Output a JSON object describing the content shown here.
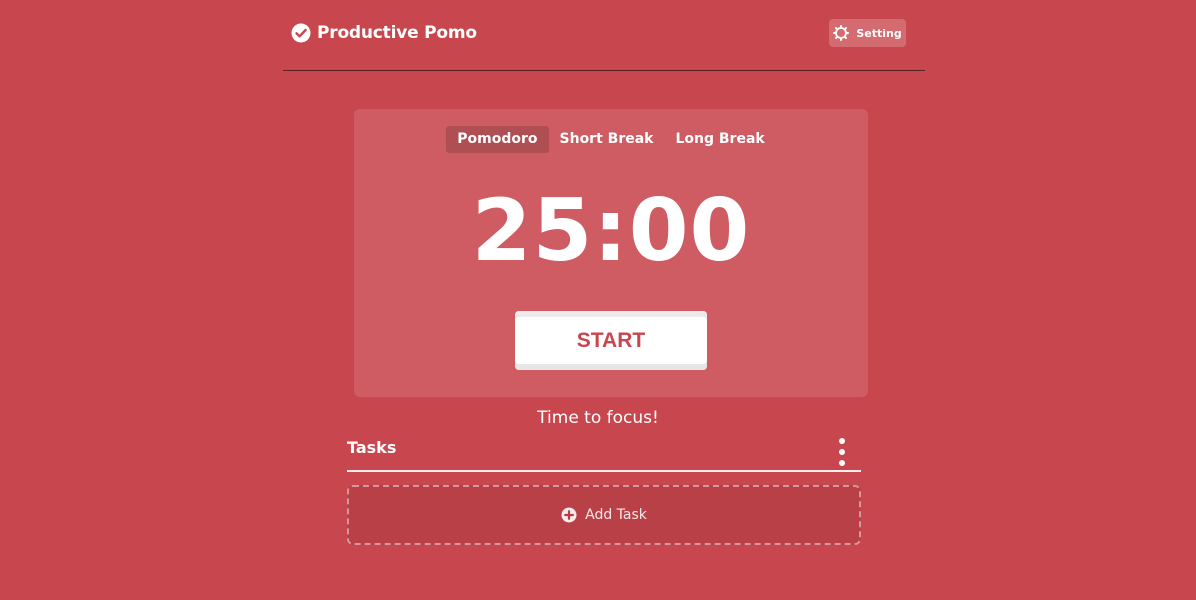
{
  "app": {
    "title": "Productive Pomo",
    "logo_icon": "check-circle-icon"
  },
  "header": {
    "setting_label": "Setting",
    "setting_icon": "gear-icon"
  },
  "timer": {
    "tabs": [
      {
        "label": "Pomodoro",
        "active": true
      },
      {
        "label": "Short Break",
        "active": false
      },
      {
        "label": "Long Break",
        "active": false
      }
    ],
    "time": "25:00",
    "start_label": "START",
    "message": "Time to focus!"
  },
  "tasks": {
    "title": "Tasks",
    "menu_icon": "more-vertical-icon",
    "add_label": "Add Task",
    "add_icon": "plus-circle-icon"
  },
  "colors": {
    "background": "#c8464d",
    "accent_text": "#c8464d",
    "foreground": "#ffffff"
  }
}
